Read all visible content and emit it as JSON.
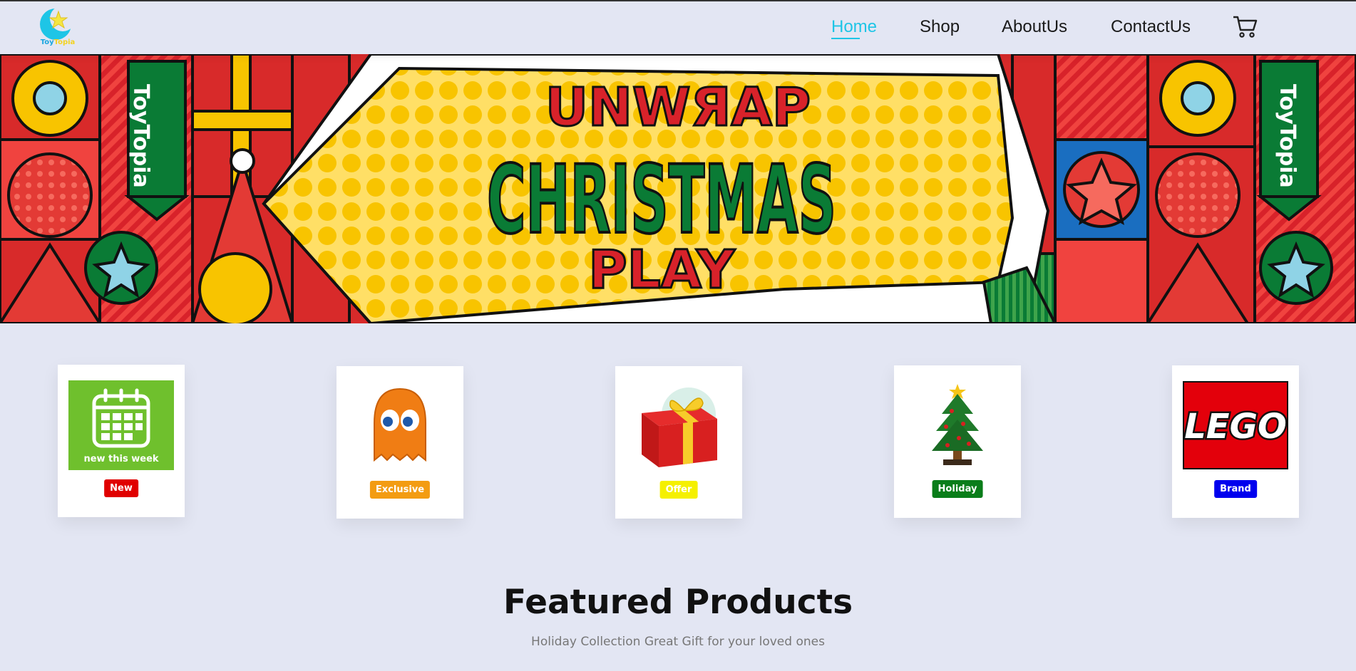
{
  "brand": {
    "logo_word_1": "Toy",
    "logo_word_2": "Topia",
    "accent": "#1ec5e6"
  },
  "nav": {
    "items": [
      {
        "label": "Home",
        "active": true
      },
      {
        "label": "Shop",
        "active": false
      },
      {
        "label": "AboutUs",
        "active": false
      },
      {
        "label": "ContactUs",
        "active": false
      }
    ],
    "cart_icon": "shopping-cart-icon"
  },
  "banner": {
    "line1": "UNWЯAP",
    "line2": "CHRISTMAS",
    "line3": "PLAY",
    "tag_text": "ToyTopia"
  },
  "categories": [
    {
      "image_caption": "new this week",
      "icon": "calendar-icon",
      "badge": "New",
      "badge_color": "#e00000"
    },
    {
      "icon": "orange-ghost-icon",
      "badge": "Exclusive",
      "badge_color": "#f39c12"
    },
    {
      "icon": "gift-box-icon",
      "badge": "Offer",
      "badge_color": "#f5f000"
    },
    {
      "icon": "christmas-tree-icon",
      "badge": "Holiday",
      "badge_color": "#0a7d1a"
    },
    {
      "image_caption": "LEGO",
      "icon": "lego-logo-icon",
      "badge": "Brand",
      "badge_color": "#0000ee"
    }
  ],
  "featured": {
    "title": "Featured Products",
    "subtitle": "Holiday Collection Great Gift for your loved ones"
  }
}
